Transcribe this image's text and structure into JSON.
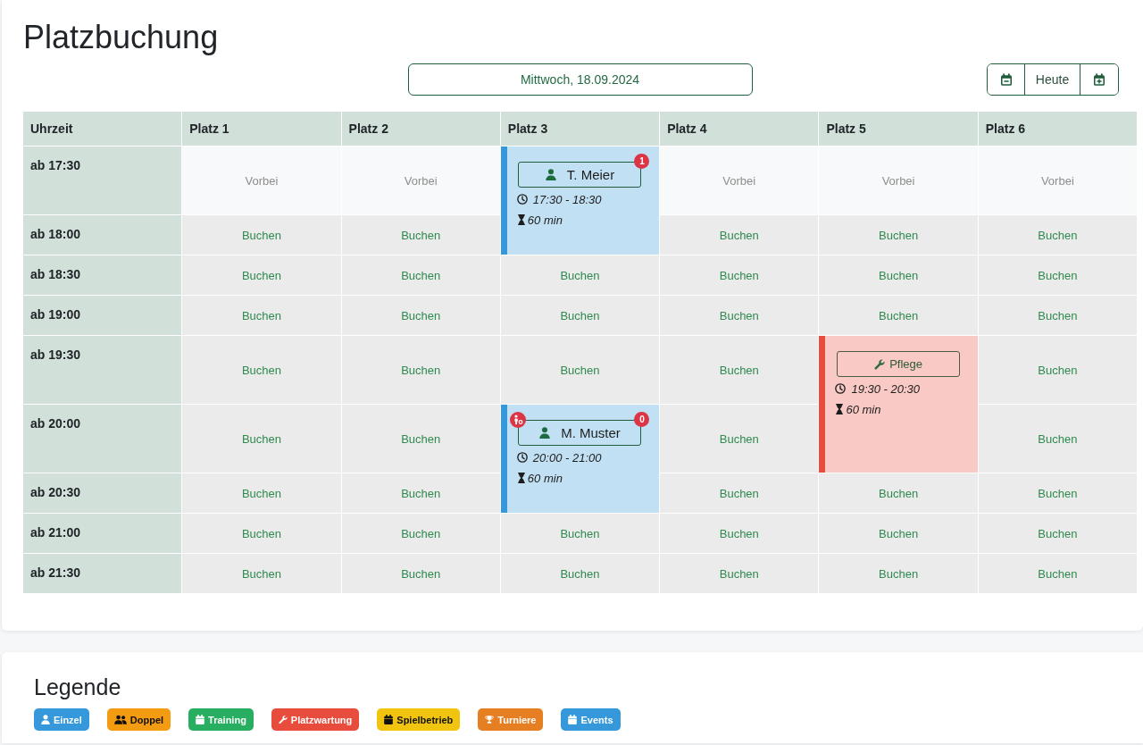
{
  "page": {
    "title": "Platzbuchung"
  },
  "date_nav": {
    "date": "Mittwoch, 18.09.2024",
    "today_button": "Heute"
  },
  "schedule": {
    "columns": [
      "Uhrzeit",
      "Platz 1",
      "Platz 2",
      "Platz 3",
      "Platz 4",
      "Platz 5",
      "Platz 6"
    ],
    "rows": [
      {
        "time": "ab 17:30",
        "cells": [
          {
            "kind": "past",
            "text": "Vorbei"
          },
          {
            "kind": "past",
            "text": "Vorbei"
          },
          {
            "kind": "booking",
            "booking": {
              "kind": "single",
              "color": "#3498db",
              "label": "T. Meier",
              "count_badge": "1",
              "icon_badge": false,
              "time": "17:30 - 18:30",
              "duration": "60 min"
            }
          },
          {
            "kind": "past",
            "text": "Vorbei"
          },
          {
            "kind": "past",
            "text": "Vorbei"
          },
          {
            "kind": "past",
            "text": "Vorbei"
          }
        ]
      },
      {
        "time": "ab 18:00",
        "cells": [
          {
            "kind": "free",
            "text": "Buchen"
          },
          {
            "kind": "free",
            "text": "Buchen"
          },
          {
            "kind": "continued"
          },
          {
            "kind": "free",
            "text": "Buchen"
          },
          {
            "kind": "free",
            "text": "Buchen"
          },
          {
            "kind": "free",
            "text": "Buchen"
          }
        ]
      },
      {
        "time": "ab 18:30",
        "cells": [
          {
            "kind": "free",
            "text": "Buchen"
          },
          {
            "kind": "free",
            "text": "Buchen"
          },
          {
            "kind": "free",
            "text": "Buchen"
          },
          {
            "kind": "free",
            "text": "Buchen"
          },
          {
            "kind": "free",
            "text": "Buchen"
          },
          {
            "kind": "free",
            "text": "Buchen"
          }
        ]
      },
      {
        "time": "ab 19:00",
        "cells": [
          {
            "kind": "free",
            "text": "Buchen"
          },
          {
            "kind": "free",
            "text": "Buchen"
          },
          {
            "kind": "free",
            "text": "Buchen"
          },
          {
            "kind": "free",
            "text": "Buchen"
          },
          {
            "kind": "free",
            "text": "Buchen"
          },
          {
            "kind": "free",
            "text": "Buchen"
          }
        ]
      },
      {
        "time": "ab 19:30",
        "cells": [
          {
            "kind": "free",
            "text": "Buchen"
          },
          {
            "kind": "free",
            "text": "Buchen"
          },
          {
            "kind": "free",
            "text": "Buchen"
          },
          {
            "kind": "free",
            "text": "Buchen"
          },
          {
            "kind": "booking",
            "booking": {
              "kind": "maintenance",
              "color": "#e74c3c",
              "label": "Pflege",
              "icon_badge": false,
              "time": "19:30 - 20:30",
              "duration": "60 min"
            }
          },
          {
            "kind": "free",
            "text": "Buchen"
          }
        ]
      },
      {
        "time": "ab 20:00",
        "cells": [
          {
            "kind": "free",
            "text": "Buchen"
          },
          {
            "kind": "free",
            "text": "Buchen"
          },
          {
            "kind": "booking",
            "booking": {
              "kind": "single",
              "color": "#3498db",
              "label": "M. Muster",
              "count_badge": "0",
              "icon_badge": true,
              "time": "20:00 - 21:00",
              "duration": "60 min"
            }
          },
          {
            "kind": "free",
            "text": "Buchen"
          },
          {
            "kind": "continued"
          },
          {
            "kind": "free",
            "text": "Buchen"
          }
        ]
      },
      {
        "time": "ab 20:30",
        "cells": [
          {
            "kind": "free",
            "text": "Buchen"
          },
          {
            "kind": "free",
            "text": "Buchen"
          },
          {
            "kind": "continued"
          },
          {
            "kind": "free",
            "text": "Buchen"
          },
          {
            "kind": "free",
            "text": "Buchen"
          },
          {
            "kind": "free",
            "text": "Buchen"
          }
        ]
      },
      {
        "time": "ab 21:00",
        "cells": [
          {
            "kind": "free",
            "text": "Buchen"
          },
          {
            "kind": "free",
            "text": "Buchen"
          },
          {
            "kind": "free",
            "text": "Buchen"
          },
          {
            "kind": "free",
            "text": "Buchen"
          },
          {
            "kind": "free",
            "text": "Buchen"
          },
          {
            "kind": "free",
            "text": "Buchen"
          }
        ]
      },
      {
        "time": "ab 21:30",
        "cells": [
          {
            "kind": "free",
            "text": "Buchen"
          },
          {
            "kind": "free",
            "text": "Buchen"
          },
          {
            "kind": "free",
            "text": "Buchen"
          },
          {
            "kind": "free",
            "text": "Buchen"
          },
          {
            "kind": "free",
            "text": "Buchen"
          },
          {
            "kind": "free",
            "text": "Buchen"
          }
        ]
      }
    ]
  },
  "legend": {
    "title": "Legende",
    "items": [
      {
        "label": "Einzel",
        "kind": "single",
        "color": "#3498db"
      },
      {
        "label": "Doppel",
        "kind": "double",
        "color": "#f39c12"
      },
      {
        "label": "Training",
        "kind": "training",
        "color": "#27ae60"
      },
      {
        "label": "Platzwartung",
        "kind": "maintenance",
        "color": "#e74c3c"
      },
      {
        "label": "Spielbetrieb",
        "kind": "league",
        "color": "#f1c40f"
      },
      {
        "label": "Turniere",
        "kind": "tournament",
        "color": "#e67e22"
      },
      {
        "label": "Events",
        "kind": "event",
        "color": "#3498db"
      }
    ]
  }
}
